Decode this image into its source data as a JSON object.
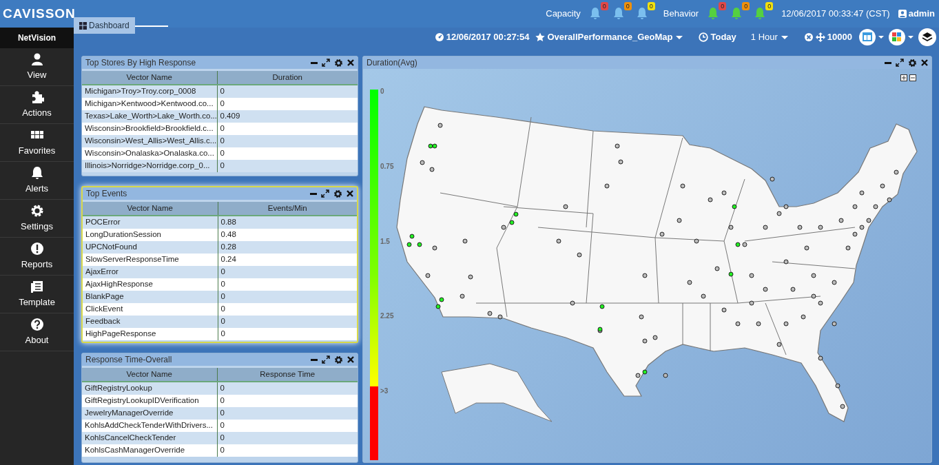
{
  "header": {
    "logo": "CAVISSON",
    "tab": {
      "label": "Dashboard",
      "selected": true
    },
    "alert_groups": [
      {
        "label": "Capacity",
        "kind": "capacity",
        "badges": [
          {
            "count": "0",
            "color": "#e04848"
          },
          {
            "count": "0",
            "color": "#f0900a"
          },
          {
            "count": "0",
            "color": "#f0e010"
          }
        ]
      },
      {
        "label": "Behavior",
        "kind": "behavior",
        "badges": [
          {
            "count": "0",
            "color": "#e04848"
          },
          {
            "count": "0",
            "color": "#f0900a"
          },
          {
            "count": "0",
            "color": "#f0e010"
          }
        ]
      }
    ],
    "datetime": "12/06/2017 00:33:47 (CST)",
    "user": "admin"
  },
  "toolbar": {
    "updated": "12/06/2017 00:27:54",
    "favorite": "OverallPerformance_GeoMap",
    "preset": "Today",
    "duration": "1 Hour",
    "limit": "10000"
  },
  "sidebar": {
    "title": "NetVision",
    "items": [
      {
        "label": "View",
        "kind": "user"
      },
      {
        "label": "Actions",
        "kind": "puzzle"
      },
      {
        "label": "Favorites",
        "kind": "grid"
      },
      {
        "label": "Alerts",
        "kind": "bell"
      },
      {
        "label": "Settings",
        "kind": "gear"
      },
      {
        "label": "Reports",
        "kind": "alert"
      },
      {
        "label": "Template",
        "kind": "doc"
      },
      {
        "label": "About",
        "kind": "help"
      }
    ]
  },
  "panels": [
    {
      "title": "Top Stores By High Response",
      "focused": false,
      "columns": [
        "Vector Name",
        "Duration"
      ],
      "rows": [
        [
          "Michigan>Troy>Troy.corp_0008",
          "0"
        ],
        [
          "Michigan>Kentwood>Kentwood.co...",
          "0"
        ],
        [
          "Texas>Lake_Worth>Lake_Worth.co...",
          "0.409"
        ],
        [
          "Wisconsin>Brookfield>Brookfield.c...",
          "0"
        ],
        [
          "Wisconsin>West_Allis>West_Allis.c...",
          "0"
        ],
        [
          "Wisconsin>Onalaska>Onalaska.co...",
          "0"
        ],
        [
          "Illinois>Norridge>Norridge.corp_0...",
          "0"
        ]
      ]
    },
    {
      "title": "Top Events",
      "focused": true,
      "columns": [
        "Vector Name",
        "Events/Min"
      ],
      "rows": [
        [
          "POCError",
          "0.88"
        ],
        [
          "LongDurationSession",
          "0.48"
        ],
        [
          "UPCNotFound",
          "0.28"
        ],
        [
          "SlowServerResponseTime",
          "0.24"
        ],
        [
          "AjaxError",
          "0"
        ],
        [
          "AjaxHighResponse",
          "0"
        ],
        [
          "BlankPage",
          "0"
        ],
        [
          "ClickEvent",
          "0"
        ],
        [
          "Feedback",
          "0"
        ],
        [
          "HighPageResponse",
          "0"
        ]
      ]
    },
    {
      "title": "Response Time-Overall",
      "focused": false,
      "columns": [
        "Vector Name",
        "Response Time"
      ],
      "rows": [
        [
          "GiftRegistryLookup",
          "0"
        ],
        [
          "GiftRegistryLookupIDVerification",
          "0"
        ],
        [
          "JewelryManagerOverride",
          "0"
        ],
        [
          "KohlsAddCheckTenderWithDrivers...",
          "0"
        ],
        [
          "KohlsCancelCheckTender",
          "0"
        ],
        [
          "KohlsCashManagerOverride",
          "0"
        ]
      ]
    }
  ],
  "map_panel": {
    "title": "Duration(Avg)",
    "legend": [
      "0",
      "0.75",
      "1.5",
      "2.25",
      ">3"
    ]
  }
}
